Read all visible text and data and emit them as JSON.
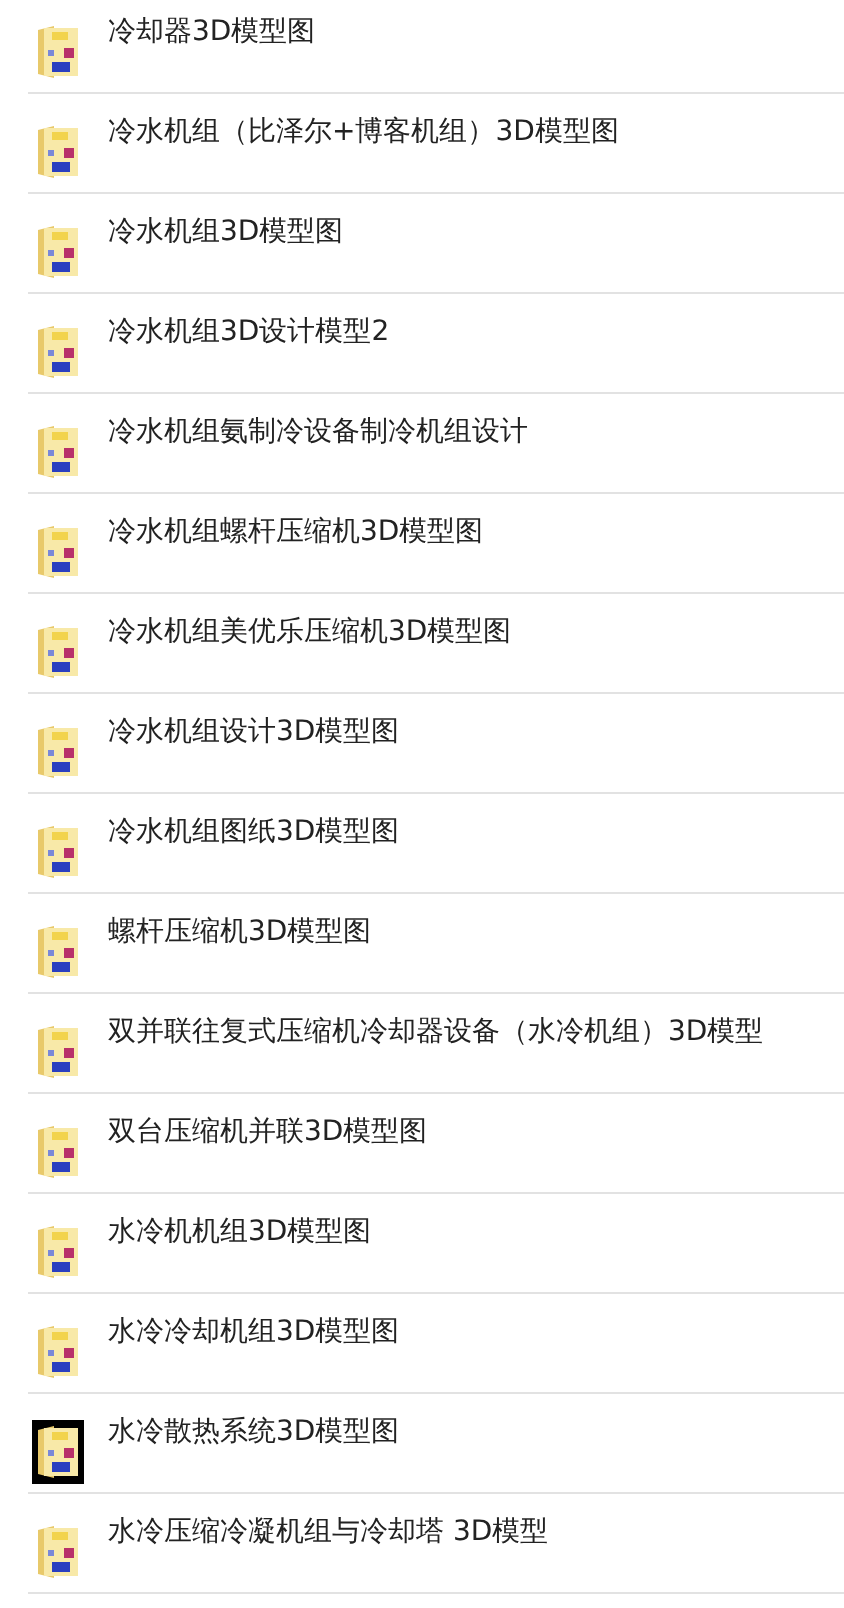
{
  "files": [
    {
      "name": "冷却器3D模型图",
      "dark_icon": false
    },
    {
      "name": "冷水机组（比泽尔+博客机组）3D模型图",
      "dark_icon": false
    },
    {
      "name": "冷水机组3D模型图",
      "dark_icon": false
    },
    {
      "name": "冷水机组3D设计模型2",
      "dark_icon": false
    },
    {
      "name": "冷水机组氨制冷设备制冷机组设计",
      "dark_icon": false
    },
    {
      "name": "冷水机组螺杆压缩机3D模型图",
      "dark_icon": false
    },
    {
      "name": "冷水机组美优乐压缩机3D模型图",
      "dark_icon": false
    },
    {
      "name": "冷水机组设计3D模型图",
      "dark_icon": false
    },
    {
      "name": "冷水机组图纸3D模型图",
      "dark_icon": false
    },
    {
      "name": "螺杆压缩机3D模型图",
      "dark_icon": false
    },
    {
      "name": "双并联往复式压缩机冷却器设备（水冷机组）3D模型",
      "dark_icon": false
    },
    {
      "name": "双台压缩机并联3D模型图",
      "dark_icon": false
    },
    {
      "name": "水冷机机组3D模型图",
      "dark_icon": false
    },
    {
      "name": "水冷冷却机组3D模型图",
      "dark_icon": false
    },
    {
      "name": "水冷散热系统3D模型图",
      "dark_icon": true
    },
    {
      "name": "水冷压缩冷凝机组与冷却塔 3D模型",
      "dark_icon": false
    }
  ]
}
